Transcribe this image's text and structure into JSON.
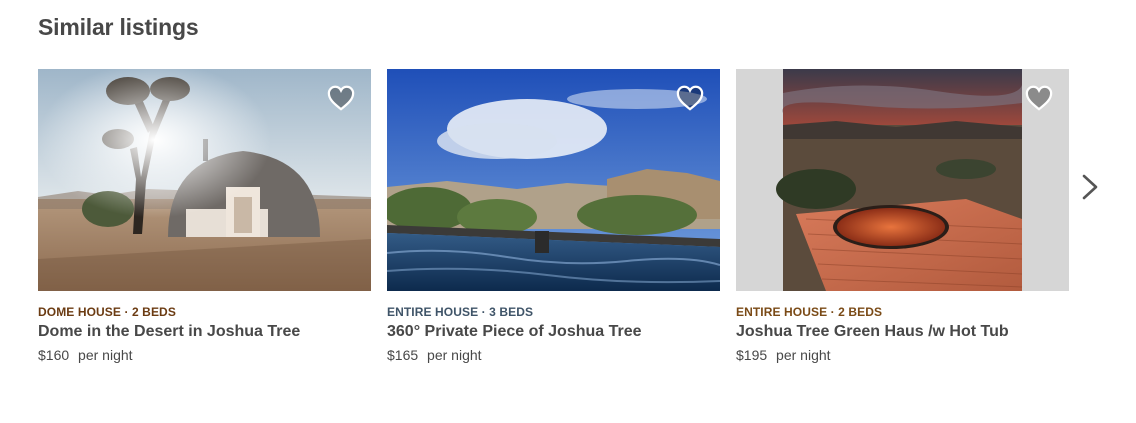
{
  "section": {
    "title": "Similar listings"
  },
  "listings": [
    {
      "kicker": "DOME HOUSE · 2 BEDS",
      "title": "Dome in the Desert in Joshua Tree",
      "price": "$160",
      "price_unit": "per night",
      "kicker_color": "#6b3b12"
    },
    {
      "kicker": "ENTIRE HOUSE · 3 BEDS",
      "title": "360° Private Piece of Joshua Tree",
      "price": "$165",
      "price_unit": "per night",
      "kicker_color": "#3f5468"
    },
    {
      "kicker": "ENTIRE HOUSE · 2 BEDS",
      "title": "Joshua Tree Green Haus /w Hot Tub",
      "price": "$195",
      "price_unit": "per night",
      "kicker_color": "#7a4a16"
    }
  ],
  "icons": {
    "save": "heart-icon",
    "next": "chevron-right-icon"
  }
}
